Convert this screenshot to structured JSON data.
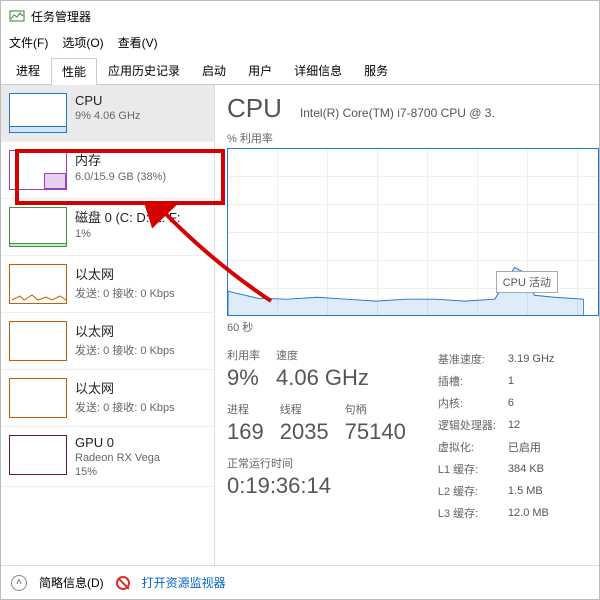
{
  "window": {
    "title": "任务管理器"
  },
  "menu": {
    "file": "文件(F)",
    "options": "选项(O)",
    "view": "查看(V)"
  },
  "tabs": [
    "进程",
    "性能",
    "应用历史记录",
    "启动",
    "用户",
    "详细信息",
    "服务"
  ],
  "active_tab": 1,
  "side": [
    {
      "kind": "cpu",
      "title": "CPU",
      "sub": "9% 4.06 GHz",
      "selected": true
    },
    {
      "kind": "mem",
      "title": "内存",
      "sub": "6.0/15.9 GB (38%)"
    },
    {
      "kind": "disk",
      "title": "磁盘 0 (C: D: E: F:",
      "sub": "1%"
    },
    {
      "kind": "net",
      "title": "以太网",
      "sub": "发送: 0 接收: 0 Kbps"
    },
    {
      "kind": "net",
      "title": "以太网",
      "sub": "发送: 0 接收: 0 Kbps"
    },
    {
      "kind": "net",
      "title": "以太网",
      "sub": "发送: 0 接收: 0 Kbps"
    },
    {
      "kind": "gpu",
      "title": "GPU 0",
      "sub": "Radeon RX Vega",
      "sub2": "15%"
    }
  ],
  "detail": {
    "heading": "CPU",
    "model": "Intel(R) Core(TM) i7-8700 CPU @ 3.",
    "chart_title": "% 利用率",
    "chart_tooltip": "CPU 活动",
    "chart_time": "60 秒",
    "row1": [
      {
        "lab": "利用率",
        "val": "9%"
      },
      {
        "lab": "速度",
        "val": "4.06 GHz"
      }
    ],
    "row2": [
      {
        "lab": "进程",
        "val": "169"
      },
      {
        "lab": "线程",
        "val": "2035"
      },
      {
        "lab": "句柄",
        "val": "75140"
      }
    ],
    "uptime": {
      "lab": "正常运行时间",
      "val": "0:19:36:14"
    },
    "right": [
      [
        "基准速度:",
        "3.19 GHz"
      ],
      [
        "插槽:",
        "1"
      ],
      [
        "内核:",
        "6"
      ],
      [
        "逻辑处理器:",
        "12"
      ],
      [
        "虚拟化:",
        "已启用"
      ],
      [
        "L1 缓存:",
        "384 KB"
      ],
      [
        "L2 缓存:",
        "1.5 MB"
      ],
      [
        "L3 缓存:",
        "12.0 MB"
      ]
    ]
  },
  "footer": {
    "brief": "简略信息(D)",
    "resmon": "打开资源监视器"
  },
  "chart_data": {
    "type": "line",
    "title": "% 利用率",
    "xlabel": "60 秒",
    "ylim": [
      0,
      100
    ],
    "x": [
      0,
      5,
      10,
      15,
      20,
      25,
      30,
      35,
      40,
      45,
      50,
      55,
      60
    ],
    "series": [
      {
        "name": "CPU 活动",
        "values": [
          14,
          10,
          9,
          11,
          9,
          8,
          10,
          9,
          8,
          9,
          28,
          12,
          9
        ]
      }
    ]
  }
}
